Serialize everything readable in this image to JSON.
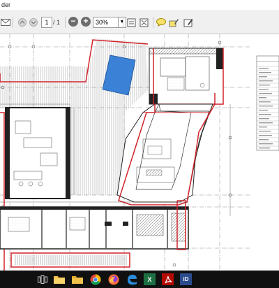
{
  "window": {
    "title_fragment": "der"
  },
  "toolbar": {
    "page_current": "1",
    "page_total": "/ 1",
    "zoom_value": "30%",
    "zoom_dropdown_glyph": "▼",
    "icons": [
      "mail-icon",
      "prev-page-icon",
      "next-page-icon",
      "zoom-out-icon",
      "zoom-in-icon",
      "fit-page-icon",
      "fit-width-icon",
      "comment-icon",
      "highlight-icon",
      "sign-icon"
    ]
  },
  "taskbar": {
    "icons": [
      "task-view-icon",
      "file-explorer-icon",
      "chrome-icon",
      "firefox-icon",
      "edge-icon",
      "excel-icon",
      "acrobat-icon",
      "id-app-icon"
    ],
    "id_label": "iD",
    "excel_label": "X"
  },
  "colors": {
    "toolbar_bg": "#f0f0f0",
    "taskbar_bg": "#101010",
    "wall_red": "#d2232a",
    "pool_blue": "#3b82d6"
  }
}
